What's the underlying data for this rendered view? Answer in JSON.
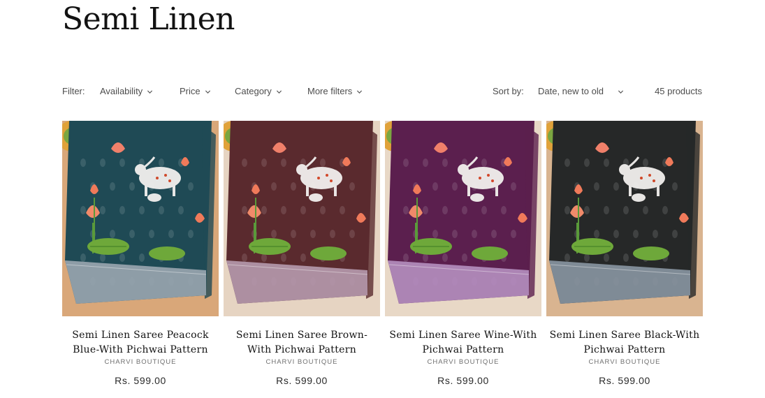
{
  "page": {
    "title": "Semi Linen"
  },
  "facets": {
    "filter_label": "Filter:",
    "filters": [
      "Availability",
      "Price",
      "Category",
      "More filters"
    ],
    "sort_label": "Sort by:",
    "sort_value": "Date, new to old",
    "product_count": "45 products"
  },
  "products": [
    {
      "title": "Semi Linen Saree Peacock Blue-With Pichwai Pattern",
      "vendor": "CHARVI BOUTIQUE",
      "price": "Rs. 599.00",
      "color": "#1f4a55",
      "border": "#9aa6b0",
      "bg": "#d9a779"
    },
    {
      "title": "Semi Linen Saree Brown-With Pichwai Pattern",
      "vendor": "CHARVI BOUTIQUE",
      "price": "Rs. 599.00",
      "color": "#5a2a2e",
      "border": "#b69aae",
      "bg": "#e6d4c2"
    },
    {
      "title": "Semi Linen Saree Wine-With Pichwai Pattern",
      "vendor": "CHARVI BOUTIQUE",
      "price": "Rs. 599.00",
      "color": "#5b1f4e",
      "border": "#b58fc0",
      "bg": "#e8d8c6"
    },
    {
      "title": "Semi Linen Saree Black-With Pichwai Pattern",
      "vendor": "CHARVI BOUTIQUE",
      "price": "Rs. 599.00",
      "color": "#262828",
      "border": "#8a96a2",
      "bg": "#d9b490"
    }
  ]
}
